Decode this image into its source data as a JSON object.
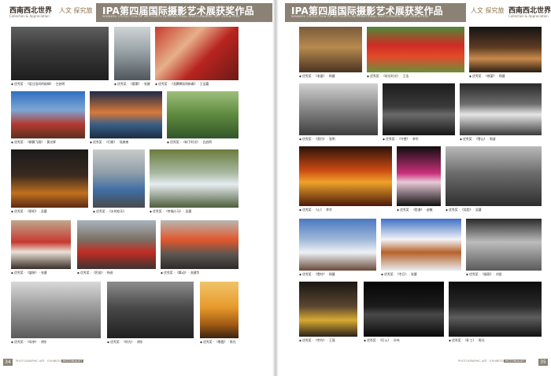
{
  "spread": {
    "header_title": "IPA第四届国际摄影艺术展获奖作品",
    "header_subtitle": "WINNERS COLLECTION OF IPA FOURTH INTERNATIONAL PHOTOGRAPHIC ART EXHIBITION",
    "logo_text": "西南西北世界",
    "logo_subtitle": "Collection & Appreciation",
    "brand_right": "人文 探究旅",
    "footer_text": "PHOTOGRAPHIC ART · EXHIBITION",
    "footer_badge": "PICTORIALIST"
  },
  "pages": {
    "left_number": "34",
    "right_number": "35"
  },
  "left_captions": [
    "◆ 优秀奖 · 《夏日田间的韵律》 · 白启明",
    "◆ 优秀奖 · 《晨雾》 · 张健",
    "◆ 优秀奖 · 《龙腾狮跃闹新春》 · 王宝嘉",
    "◆ 优秀奖 · 《鹤舞飞翔》 · 黄光辉",
    "◆ 优秀奖 · 《归帆》 · 陆南南",
    "◆ 优秀奖 · 《树下时光》 · 白启明",
    "◆ 优秀奖 · 《祭祀》 · 吴健",
    "◆ 优秀奖 · 《水的欢乐》",
    "◆ 优秀奖 · 《幸福小马》 · 吴健",
    "◆ 优秀奖 · 《盛装》 · 张健",
    "◆ 优秀奖 · 《民俗》 · 杨进",
    "◆ 优秀奖 · 《舞动》 · 苏建华",
    "◆ 优秀奖 · 《母亲》 · 胡东",
    "◆ 优秀奖 · 《时光》 · 胡东",
    "◆ 优秀奖 · 《晚霞》 · 陈光"
  ],
  "right_captions": [
    "◆ 优秀奖 · 《老屋》 · 杨健",
    "◆ 优秀奖 · 《欢乐时光》 · 王浩",
    "◆ 优秀奖 · 《夜宴》 · 杨健",
    "◆ 优秀奖 · 《渔归》 · 张明",
    "◆ 优秀奖 · 《守望》 · 李华",
    "◆ 优秀奖 · 《雪山》 · 周波",
    "◆ 优秀奖 · 《火》 · 李华",
    "◆ 优秀奖 · 《脸谱》 · 赵敏",
    "◆ 优秀奖 · 《笑脸》 · 吴健",
    "◆ 优秀奖 · 《雪村》 · 杨健",
    "◆ 优秀奖 · 《冬日》 · 张健",
    "◆ 优秀奖 · 《烟雨》 · 刘凯",
    "◆ 优秀奖 · 《劳作》 · 王强",
    "◆ 优秀奖 · 《灯火》 · 孙伟",
    "◆ 优秀奖 · 《矿工》 · 陈光"
  ],
  "colors": {
    "header_band": "#8b8275",
    "page_background": "#ffffff"
  }
}
